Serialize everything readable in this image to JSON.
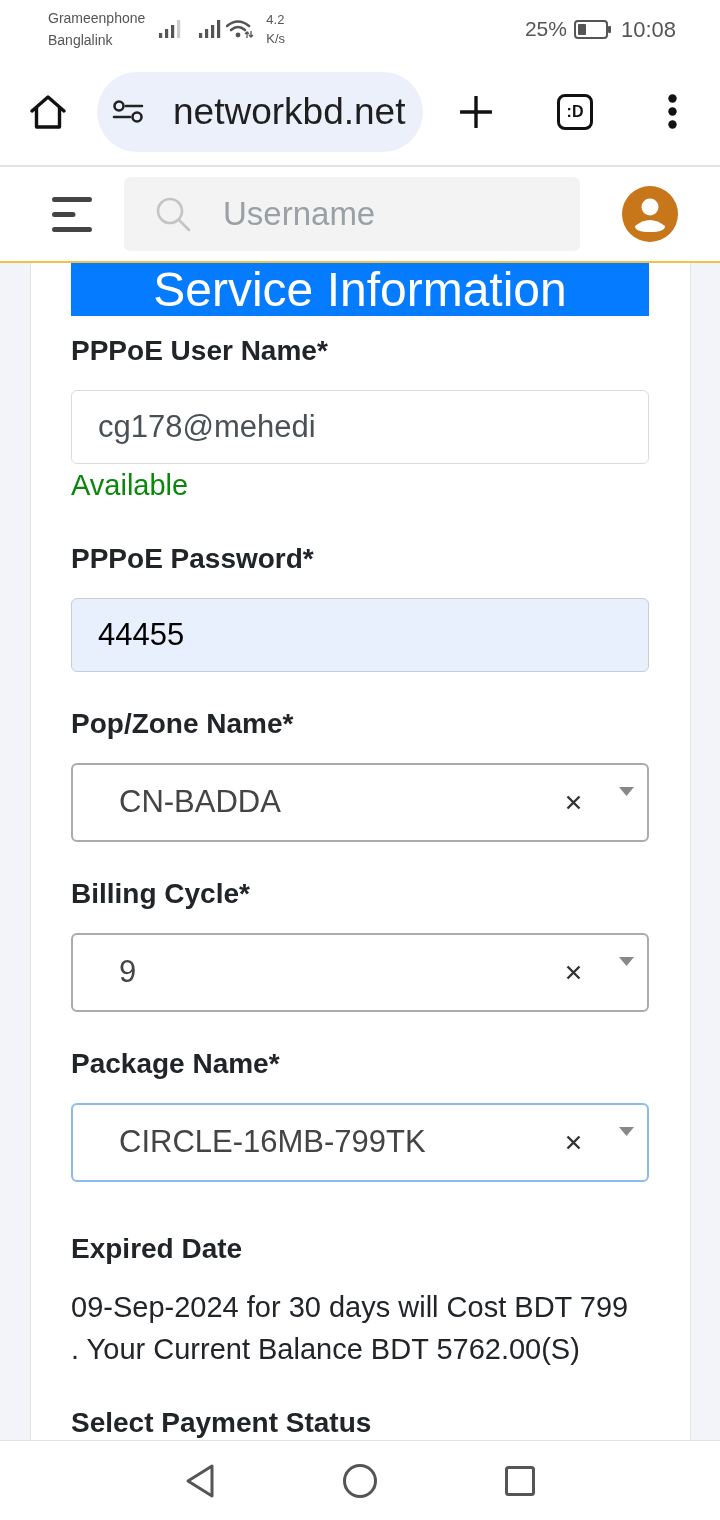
{
  "status_bar": {
    "carriers": [
      "Grameenphone",
      "Banglalink"
    ],
    "speed": [
      "4.2",
      "K/s"
    ],
    "battery": "25%",
    "time": "10:08"
  },
  "browser_toolbar": {
    "url": "networkbd.net",
    "tab_count": ":D"
  },
  "app_header": {
    "search": {
      "placeholder": "Username"
    }
  },
  "form": {
    "title": "Service Information",
    "fields": [
      {
        "kind": "text",
        "label": "PPPoE User Name*",
        "value": "cg178@mehedi",
        "autofilled": false,
        "hint": "Available"
      },
      {
        "kind": "text",
        "label": "PPPoE Password*",
        "value": "44455",
        "autofilled": true
      },
      {
        "kind": "select",
        "label": "Pop/Zone Name*",
        "value": "CN-BADDA",
        "focused": false
      },
      {
        "kind": "select",
        "label": "Billing Cycle*",
        "value": "9",
        "focused": false
      },
      {
        "kind": "select",
        "label": "Package Name*",
        "value": "CIRCLE-16MB-799TK",
        "focused": true
      },
      {
        "kind": "info",
        "label": "Expired Date",
        "text": "09-Sep-2024 for 30 days will Cost BDT 799 . Your Current Balance BDT 5762.00(S)"
      },
      {
        "kind": "heading",
        "label": "Select Payment Status"
      }
    ]
  }
}
